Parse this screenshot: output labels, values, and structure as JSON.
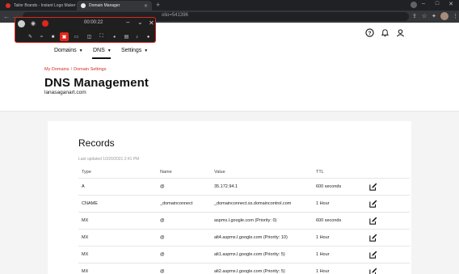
{
  "browser": {
    "tabs": [
      {
        "title": "Tailor Brands - Instant Logo Maker",
        "favicon_color": "#d93025"
      },
      {
        "title": "Domain Manager",
        "favicon_color": "#ffffff"
      }
    ],
    "url_fragment": "olio=541396"
  },
  "recorder": {
    "timer": "00:00:22"
  },
  "site_nav": {
    "items": [
      {
        "label": "Domains"
      },
      {
        "label": "DNS"
      },
      {
        "label": "Settings"
      }
    ]
  },
  "breadcrumb": {
    "items": [
      "My Domains",
      "Domain Settings"
    ],
    "separator": "/"
  },
  "page": {
    "title": "DNS Management",
    "domain": "lanasaganart.com"
  },
  "records": {
    "title": "Records",
    "last_updated": "Last updated 10/20/2021 2:41 PM",
    "headers": [
      "Type",
      "Name",
      "Value",
      "TTL"
    ],
    "rows": [
      {
        "type": "A",
        "name": "@",
        "value": "35.172.94.1",
        "ttl": "600 seconds"
      },
      {
        "type": "CNAME",
        "name": "_domainconnect",
        "value": "_domainconnect.ss.domaincontrol.com",
        "ttl": "1 Hour"
      },
      {
        "type": "MX",
        "name": "@",
        "value": "aspmx.l.google.com (Priority: 0)",
        "ttl": "600 seconds"
      },
      {
        "type": "MX",
        "name": "@",
        "value": "alt4.aspmx.l.google.com (Priority: 10)",
        "ttl": "1 Hour"
      },
      {
        "type": "MX",
        "name": "@",
        "value": "alt1.aspmx.l.google.com (Priority: 5)",
        "ttl": "1 Hour"
      },
      {
        "type": "MX",
        "name": "@",
        "value": "alt2.aspmx.l.google.com (Priority: 5)",
        "ttl": "1 Hour"
      }
    ]
  },
  "colors": {
    "accent_red": "#d12e1f",
    "chrome_dark": "#202124"
  }
}
